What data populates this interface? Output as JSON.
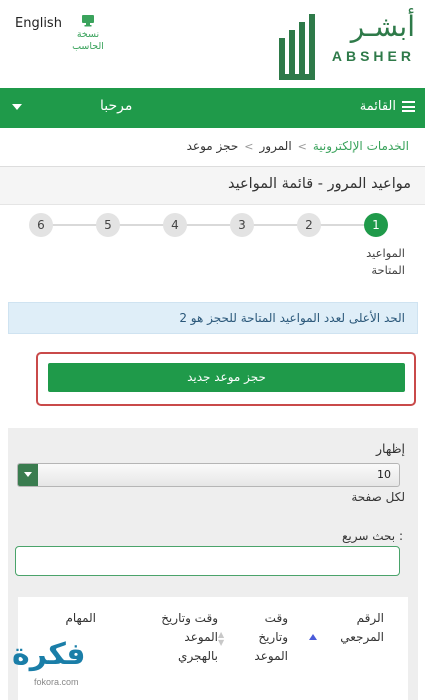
{
  "header": {
    "language_link": "English",
    "desktop_version_label": "نسخة الحاسب",
    "logo_arabic": "أبشـر",
    "logo_english": "ABSHER"
  },
  "nav": {
    "menu_label": "القائمة",
    "welcome": "مرحبا"
  },
  "breadcrumb": {
    "items": [
      "الخدمات الإلكترونية",
      "المرور",
      "حجز موعد"
    ],
    "separator": ">"
  },
  "panel": {
    "title": "مواعيد المرور - قائمة المواعيد"
  },
  "stepper": {
    "steps": [
      "1",
      "2",
      "3",
      "4",
      "5",
      "6"
    ],
    "active_step": 1,
    "active_label": "المواعيد المتاحة"
  },
  "alert": {
    "text": "الحد الأعلى لعدد المواعيد المتاحة للحجز هو 2"
  },
  "actions": {
    "new_booking": "حجز موعد جديد"
  },
  "table_controls": {
    "show_label": "إظهار",
    "page_size_value": "10",
    "per_page_label": "لكل صفحة",
    "search_label": "بحث سريع :"
  },
  "table": {
    "columns": [
      "الرقم المرجعي",
      "وقت وتاريخ الموعد",
      "وقت وتاريخ الموعد بالهجري",
      "المهام"
    ]
  },
  "watermark": {
    "text": "فكرة",
    "url": "fokora.com"
  },
  "colors": {
    "primary_green": "#1f9a4a",
    "alert_bg": "#dfeef8",
    "highlight_red": "#c94a4a"
  }
}
